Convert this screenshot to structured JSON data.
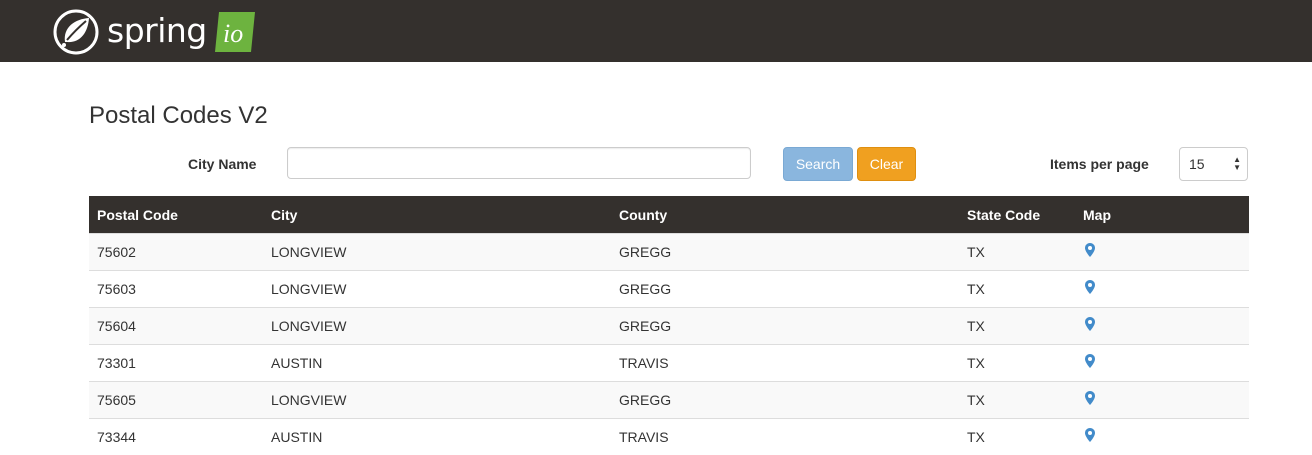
{
  "brand": {
    "wordmark": "spring",
    "badge": "io"
  },
  "page": {
    "title": "Postal Codes V2"
  },
  "search": {
    "label": "City Name",
    "value": "",
    "placeholder": "",
    "search_button": "Search",
    "clear_button": "Clear"
  },
  "items_per_page": {
    "label": "Items per page",
    "value": "15"
  },
  "table": {
    "columns": [
      "Postal Code",
      "City",
      "County",
      "State Code",
      "Map"
    ],
    "rows": [
      {
        "postal_code": "75602",
        "city": "LONGVIEW",
        "county": "GREGG",
        "state": "TX",
        "map_icon": "map-marker-icon"
      },
      {
        "postal_code": "75603",
        "city": "LONGVIEW",
        "county": "GREGG",
        "state": "TX",
        "map_icon": "map-marker-icon"
      },
      {
        "postal_code": "75604",
        "city": "LONGVIEW",
        "county": "GREGG",
        "state": "TX",
        "map_icon": "map-marker-icon"
      },
      {
        "postal_code": "73301",
        "city": "AUSTIN",
        "county": "TRAVIS",
        "state": "TX",
        "map_icon": "map-marker-icon"
      },
      {
        "postal_code": "75605",
        "city": "LONGVIEW",
        "county": "GREGG",
        "state": "TX",
        "map_icon": "map-marker-icon"
      },
      {
        "postal_code": "73344",
        "city": "AUSTIN",
        "county": "TRAVIS",
        "state": "TX",
        "map_icon": "map-marker-icon"
      }
    ]
  },
  "colors": {
    "navbar": "#34302d",
    "spring_green": "#6db33f",
    "search_button": "#8ab6de",
    "clear_button": "#f0a020",
    "map_pin": "#428bca"
  }
}
